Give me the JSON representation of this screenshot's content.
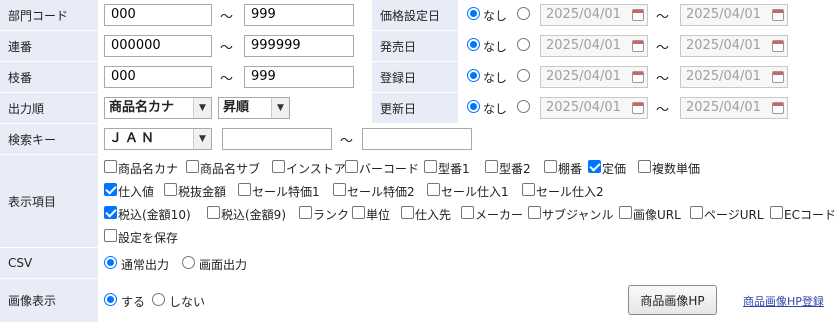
{
  "labels": {
    "dept_code": "部門コード",
    "serial": "連番",
    "branch": "枝番",
    "output_order": "出力順",
    "search_key": "検索キー",
    "display_items": "表示項目",
    "csv": "CSV",
    "image_display": "画像表示",
    "price_date": "価格設定日",
    "release_date": "発売日",
    "register_date": "登録日",
    "update_date": "更新日"
  },
  "ranges": {
    "dept_from": "000",
    "dept_to": "999",
    "serial_from": "000000",
    "serial_to": "999999",
    "branch_from": "000",
    "branch_to": "999",
    "tilde": "～"
  },
  "sort": {
    "field": "商品名カナ",
    "direction": "昇順"
  },
  "search": {
    "key": "ＪＡＮ",
    "from": "",
    "to": ""
  },
  "date_filters": {
    "none_label": "なし",
    "from": "2025/04/01",
    "to": "2025/04/01"
  },
  "display_items": [
    {
      "label": "商品名カナ",
      "checked": false
    },
    {
      "label": "商品名サブ",
      "checked": false
    },
    {
      "label": "インストア",
      "checked": false
    },
    {
      "label": "バーコード",
      "checked": false
    },
    {
      "label": "型番1",
      "checked": false
    },
    {
      "label": "型番2",
      "checked": false
    },
    {
      "label": "棚番",
      "checked": false
    },
    {
      "label": "定価",
      "checked": true
    },
    {
      "label": "複数単価",
      "checked": false
    },
    {
      "label": "仕入値",
      "checked": true
    },
    {
      "label": "税抜金額",
      "checked": false
    },
    {
      "label": "セール特価1",
      "checked": false
    },
    {
      "label": "セール特価2",
      "checked": false
    },
    {
      "label": "セール仕入1",
      "checked": false
    },
    {
      "label": "セール仕入2",
      "checked": false
    },
    {
      "label": "税込(金額10)",
      "checked": true
    },
    {
      "label": "税込(金額9)",
      "checked": false
    },
    {
      "label": "ランク",
      "checked": false
    },
    {
      "label": "単位",
      "checked": false
    },
    {
      "label": "仕入先",
      "checked": false
    },
    {
      "label": "メーカー",
      "checked": false
    },
    {
      "label": "サブジャンル",
      "checked": false
    },
    {
      "label": "画像URL",
      "checked": false
    },
    {
      "label": "ページURL",
      "checked": false
    },
    {
      "label": "ECコード",
      "checked": false
    },
    {
      "label": "設定を保存",
      "checked": false
    }
  ],
  "csv": {
    "normal": "通常出力",
    "screen": "画面出力",
    "selected": "normal"
  },
  "image": {
    "yes": "する",
    "no": "しない",
    "selected": "yes"
  },
  "buttons": {
    "image_hp": "商品画像HP"
  },
  "links": {
    "image_hp_register": "商品画像HP登録"
  },
  "colors": {
    "label_bg": "#e8ecf7",
    "accent": "#0075ff"
  }
}
